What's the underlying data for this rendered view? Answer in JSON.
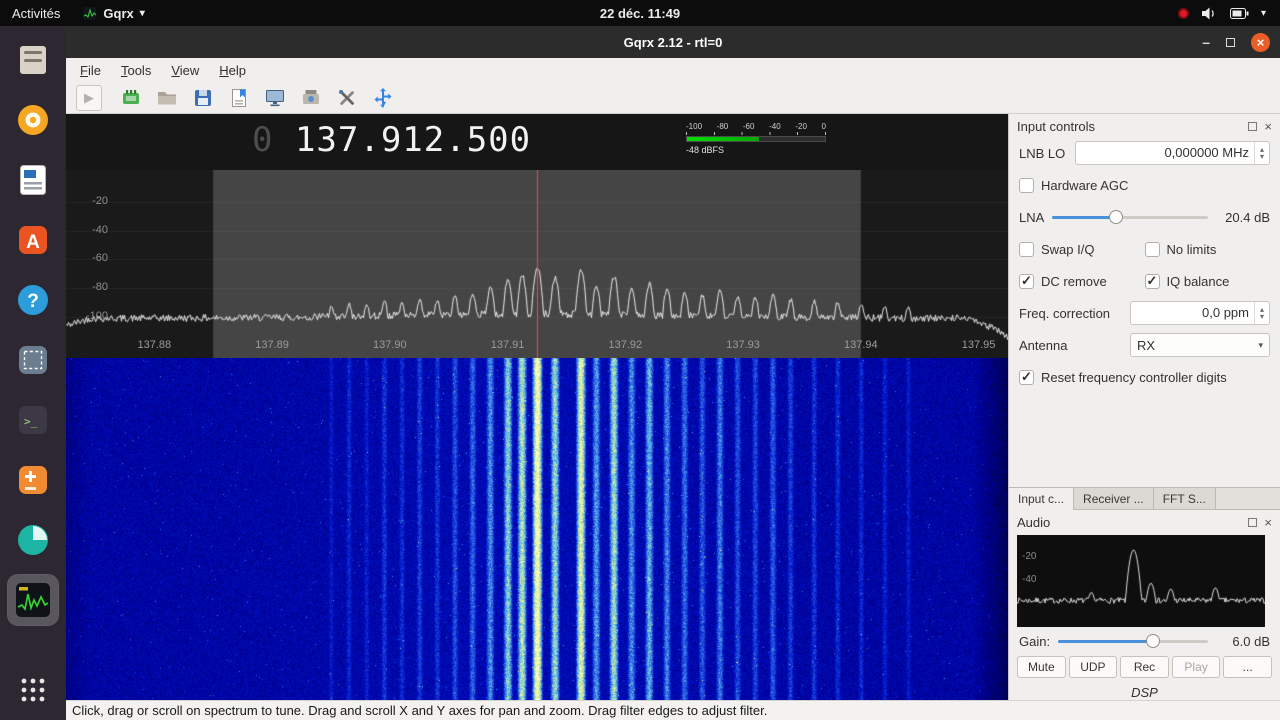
{
  "icons": {
    "caret_down": "▾",
    "caret_up": "▴",
    "play": "▶",
    "window_minimize": "–",
    "window_close": "×"
  },
  "top_bar": {
    "activities_label": "Activités",
    "app_menu_label": "Gqrx",
    "clock": "22 déc.  11:49"
  },
  "dock": {
    "icons": [
      "files-icon",
      "media-player-icon",
      "writer-icon",
      "ubuntu-software-icon",
      "help-icon",
      "screenshot-tool-icon",
      "terminal-icon",
      "software-updater-icon",
      "disk-usage-icon",
      "gqrx-icon",
      "app-grid-icon"
    ],
    "active_item": "gqrx-icon"
  },
  "window": {
    "title": "Gqrx 2.12 - rtl=0",
    "menu_items": [
      "File",
      "Tools",
      "View",
      "Help"
    ]
  },
  "frequency": {
    "leading_zero": "0 ",
    "display": "137.912.500"
  },
  "meter": {
    "scale_labels": [
      "-100",
      "-80",
      "-60",
      "-40",
      "-20",
      "0"
    ],
    "reading": "-48 dBFS",
    "level_percent": 52
  },
  "spectrum": {
    "db_labels": [
      "-20",
      "-40",
      "-60",
      "-80",
      "-100"
    ],
    "freq_labels": [
      "137.88",
      "137.89",
      "137.90",
      "137.91",
      "137.92",
      "137.93",
      "137.94",
      "137.95"
    ],
    "fmin": 137.8725,
    "fmax": 137.9525,
    "floor_db": -101,
    "tuned_freq": 137.9125,
    "filter_region": [
      137.885,
      137.94
    ],
    "peaks": [
      [
        137.895,
        -93
      ],
      [
        137.8965,
        -91
      ],
      [
        137.898,
        -92
      ],
      [
        137.8995,
        -89
      ],
      [
        137.901,
        -90
      ],
      [
        137.9025,
        -88
      ],
      [
        137.904,
        -89
      ],
      [
        137.9055,
        -86
      ],
      [
        137.907,
        -84
      ],
      [
        137.9085,
        -80
      ],
      [
        137.91,
        -74
      ],
      [
        137.9112,
        -71
      ],
      [
        137.9125,
        -65
      ],
      [
        137.914,
        -73
      ],
      [
        137.9162,
        -68
      ],
      [
        137.9175,
        -79
      ],
      [
        137.919,
        -72
      ],
      [
        137.9205,
        -80
      ],
      [
        137.922,
        -77
      ],
      [
        137.9235,
        -81
      ],
      [
        137.925,
        -83
      ],
      [
        137.9265,
        -85
      ],
      [
        137.928,
        -82
      ],
      [
        137.9295,
        -86
      ],
      [
        137.931,
        -87
      ],
      [
        137.9325,
        -85
      ],
      [
        137.934,
        -88
      ],
      [
        137.936,
        -89
      ],
      [
        137.938,
        -90
      ],
      [
        137.94,
        -91
      ],
      [
        137.942,
        -92
      ],
      [
        137.944,
        -93
      ]
    ]
  },
  "input_controls": {
    "title": "Input controls",
    "lnb_lo_label": "LNB LO",
    "lnb_lo_value": "0,000000 MHz",
    "hardware_agc_label": "Hardware AGC",
    "hardware_agc_checked": false,
    "lna_label": "LNA",
    "lna_value": "20.4 dB",
    "lna_percent": 41,
    "swap_iq_label": "Swap I/Q",
    "swap_iq_checked": false,
    "no_limits_label": "No limits",
    "no_limits_checked": false,
    "dc_remove_label": "DC remove",
    "dc_remove_checked": true,
    "iq_balance_label": "IQ balance",
    "iq_balance_checked": true,
    "freq_correction_label": "Freq. correction",
    "freq_correction_value": "0,0 ppm",
    "antenna_label": "Antenna",
    "antenna_value": "RX",
    "reset_digits_label": "Reset frequency controller digits",
    "reset_digits_checked": true
  },
  "tabs": {
    "items": [
      "Input c...",
      "Receiver ...",
      "FFT S..."
    ],
    "active": "Input c..."
  },
  "audio": {
    "title": "Audio",
    "db_labels": [
      "-20",
      "-40"
    ],
    "gain_label": "Gain:",
    "gain_value": "6.0 dB",
    "gain_percent": 63,
    "buttons": [
      "Mute",
      "UDP",
      "Rec",
      "Play",
      "..."
    ],
    "disabled_button": "Play",
    "footer": "DSP"
  },
  "status_bar": {
    "message": "Click, drag or scroll on spectrum to tune. Drag and scroll X and Y axes for pan and zoom. Drag filter edges to adjust filter."
  }
}
